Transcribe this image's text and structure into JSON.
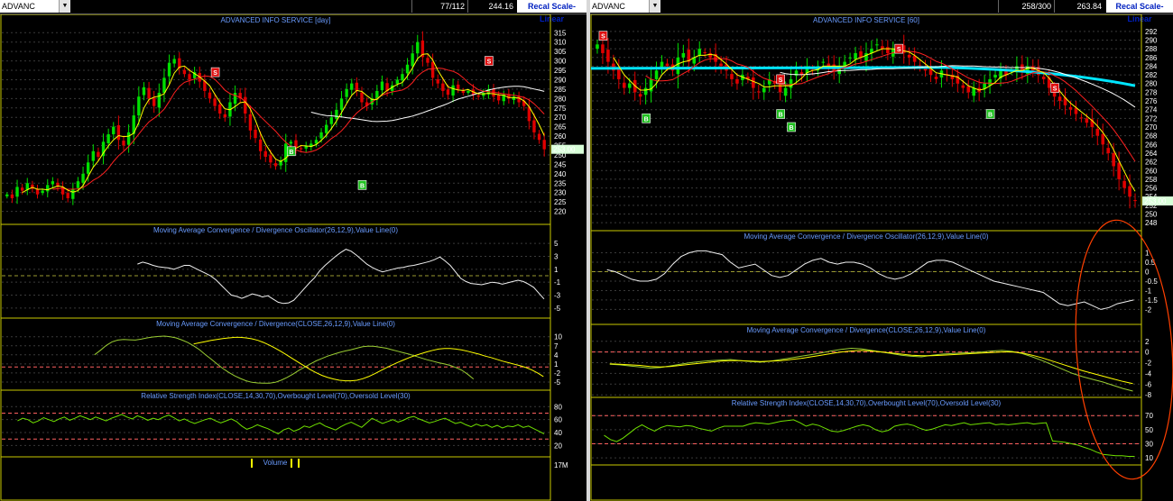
{
  "left": {
    "symbol": "ADVANC",
    "counter": "77/112",
    "price_box": "244.16",
    "recal_label": "Recal Scale-Linear",
    "price_tag": "253.00"
  },
  "right": {
    "symbol": "ADVANC",
    "counter": "258/300",
    "price_box": "263.84",
    "recal_label": "Recal Scale-Linear",
    "price_tag": "253.00"
  },
  "colors": {
    "up": "#00e000",
    "down": "#e00000",
    "ma_fast": "#ffff00",
    "ma_mid": "#ff2020",
    "ma_slow": "#ffffff",
    "ma_cyan": "#00e5ff",
    "title": "#6a9cff",
    "frame": "#c8c800",
    "ref_line": "#ff6060",
    "ellipse": "#ff4000"
  },
  "chart_data": [
    {
      "type": "candlestick",
      "id": "left-price",
      "title": "ADVANCED INFO SERVICE [day]",
      "ylim": [
        215,
        318
      ],
      "yticks": [
        220,
        225,
        230,
        235,
        240,
        245,
        250,
        255,
        260,
        265,
        270,
        275,
        280,
        285,
        290,
        295,
        300,
        305,
        310,
        315
      ],
      "close": [
        229,
        227,
        233,
        231,
        235,
        232,
        229,
        231,
        234,
        236,
        233,
        229,
        227,
        232,
        236,
        240,
        246,
        252,
        249,
        257,
        261,
        265,
        258,
        255,
        262,
        271,
        281,
        286,
        280,
        276,
        283,
        291,
        299,
        301,
        296,
        293,
        290,
        294,
        289,
        284,
        280,
        276,
        272,
        270,
        278,
        283,
        280,
        272,
        263,
        259,
        252,
        249,
        246,
        244,
        247,
        256,
        257,
        254,
        253,
        255,
        256,
        258,
        262,
        266,
        270,
        274,
        280,
        285,
        288,
        284,
        278,
        276,
        280,
        284,
        289,
        284,
        287,
        290,
        293,
        298,
        304,
        310,
        302,
        299,
        291,
        288,
        284,
        282,
        287,
        285,
        283,
        284,
        282,
        281,
        283,
        285,
        281,
        279,
        282,
        280,
        281,
        278,
        276,
        268,
        262,
        258,
        253
      ],
      "signals": [
        {
          "label": "S",
          "idx": 41,
          "price": 294
        },
        {
          "label": "B",
          "idx": 56,
          "price": 252
        },
        {
          "label": "B",
          "idx": 70,
          "price": 234
        },
        {
          "label": "S",
          "idx": 95,
          "price": 300
        }
      ],
      "ma_fast": {
        "name": "fast",
        "period": 4
      },
      "ma_mid": {
        "name": "mid",
        "period": 10
      },
      "ma_slow": {
        "name": "slow",
        "period": 35,
        "start": 60
      }
    },
    {
      "type": "line",
      "id": "left-macd-osc",
      "title": "Moving Average Convergence / Divergence Oscillator(26,12,9),Value Line(0)",
      "ylim": [
        -6,
        6
      ],
      "yticks": [
        5,
        3,
        1,
        -1,
        -3,
        -5
      ],
      "zero": 0,
      "start": 25,
      "values": [
        1.8,
        2.1,
        1.9,
        1.6,
        1.4,
        1.3,
        1.2,
        1.0,
        1.3,
        1.6,
        1.6,
        1.2,
        0.8,
        0.4,
        0.0,
        -0.6,
        -1.4,
        -2.2,
        -3.0,
        -3.2,
        -3.5,
        -3.2,
        -2.8,
        -3.0,
        -3.3,
        -3.1,
        -3.6,
        -4.1,
        -4.3,
        -4.2,
        -3.8,
        -2.9,
        -2.0,
        -1.1,
        -0.3,
        0.8,
        1.6,
        2.3,
        3.0,
        3.6,
        4.1,
        3.8,
        3.2,
        2.5,
        1.8,
        1.3,
        0.9,
        0.6,
        0.8,
        1.0,
        1.2,
        1.3,
        1.5,
        1.6,
        1.8,
        2.0,
        2.2,
        2.5,
        2.9,
        2.3,
        1.6,
        0.6,
        -0.4,
        -0.9,
        -1.2,
        -1.3,
        -1.4,
        -1.2,
        -1.0,
        -1.1,
        -1.3,
        -1.1,
        -0.9,
        -0.7,
        -0.9,
        -1.3,
        -1.8,
        -2.7,
        -3.6
      ]
    },
    {
      "type": "line",
      "id": "left-macd",
      "title": "Moving Average Convergence / Divergence(CLOSE,26,12,9),Value Line(0)",
      "ylim": [
        -6.5,
        12
      ],
      "yticks": [
        10,
        7,
        4,
        1,
        -2,
        -5
      ],
      "zero": 0,
      "series": [
        {
          "name": "MACD",
          "color": "#9acd32",
          "start": 15,
          "values": [
            4.0,
            5.5,
            7.1,
            8.3,
            8.9,
            9.1,
            9.0,
            8.9,
            9.2,
            9.6,
            9.9,
            10.1,
            10.2,
            10.0,
            9.6,
            8.9,
            8.1,
            7.0,
            5.7,
            4.1,
            2.6,
            1.0,
            -0.5,
            -1.8,
            -2.9,
            -3.8,
            -4.6,
            -5.1,
            -5.3,
            -5.4,
            -5.4,
            -5.1,
            -4.4,
            -3.5,
            -2.4,
            -1.2,
            -0.1,
            1.0,
            2.0,
            2.8,
            3.6,
            4.2,
            4.8,
            5.3,
            5.7,
            6.2,
            6.7,
            6.9,
            6.8,
            6.5,
            6.2,
            5.7,
            5.2,
            4.7,
            4.2,
            3.6,
            3.0,
            2.4,
            1.9,
            1.4,
            1.0,
            0.5,
            -0.2,
            -1.1,
            -2.4,
            -4.0
          ]
        },
        {
          "name": "Signal",
          "color": "#ffff00",
          "start": 32,
          "values": [
            7.6,
            8.0,
            8.4,
            8.8,
            9.1,
            9.4,
            9.6,
            9.8,
            9.8,
            9.6,
            9.3,
            8.8,
            8.1,
            7.2,
            6.2,
            5.1,
            3.9,
            2.7,
            1.5,
            0.3,
            -0.9,
            -1.9,
            -2.8,
            -3.5,
            -4.0,
            -4.4,
            -4.6,
            -4.6,
            -4.4,
            -3.9,
            -3.2,
            -2.3,
            -1.3,
            -0.3,
            0.6,
            1.5,
            2.3,
            3.1,
            3.8,
            4.4,
            5.0,
            5.5,
            5.9,
            6.1,
            6.1,
            5.9,
            5.6,
            5.2,
            4.7,
            4.2,
            3.6,
            3.1,
            2.5,
            1.9,
            1.4,
            0.9,
            0.4,
            -0.2,
            -1.0,
            -2.0,
            -3.2
          ]
        }
      ]
    },
    {
      "type": "line",
      "id": "left-rsi",
      "title": "Relative Strength Index(CLOSE,14,30,70),Overbought Level(70),Oversold Level(30)",
      "ylim": [
        8,
        86
      ],
      "yticks": [
        80,
        60,
        40,
        20
      ],
      "overbought": 70,
      "oversold": 30,
      "start": 2,
      "values": [
        58,
        62,
        60,
        55,
        58,
        63,
        60,
        57,
        61,
        64,
        59,
        62,
        66,
        63,
        60,
        64,
        61,
        58,
        62,
        65,
        68,
        64,
        61,
        66,
        63,
        59,
        62,
        60,
        64,
        67,
        63,
        58,
        61,
        57,
        54,
        57,
        60,
        62,
        58,
        55,
        58,
        61,
        57,
        50,
        45,
        48,
        52,
        49,
        46,
        42,
        38,
        44,
        47,
        42,
        45,
        50,
        48,
        52,
        55,
        50,
        47,
        44,
        49,
        53,
        56,
        52,
        48,
        55,
        62,
        58,
        54,
        57,
        60,
        56,
        59,
        63,
        65,
        61,
        58,
        55,
        57,
        60,
        62,
        58,
        54,
        56,
        52,
        49,
        53,
        50,
        52,
        48,
        51,
        47,
        50,
        49,
        52,
        48,
        50,
        46,
        42,
        38
      ]
    },
    {
      "type": "bar",
      "id": "left-volume",
      "title": "Volume",
      "yticks": [
        "17M"
      ]
    },
    {
      "type": "candlestick",
      "id": "right-price",
      "title": "ADVANCED INFO SERVICE [60]",
      "ylim": [
        247,
        293
      ],
      "yticks": [
        292,
        290,
        288,
        286,
        284,
        282,
        280,
        278,
        276,
        274,
        272,
        270,
        268,
        266,
        264,
        262,
        260,
        258,
        256,
        254,
        252,
        250,
        248
      ],
      "close": [
        289,
        287,
        285,
        283,
        281,
        279,
        280,
        278,
        277,
        279,
        281,
        283,
        285,
        284,
        283,
        286,
        287,
        285,
        286,
        288,
        287,
        286,
        285,
        284,
        283,
        281,
        280,
        282,
        281,
        279,
        278,
        279,
        281,
        280,
        278,
        279,
        281,
        283,
        282,
        284,
        283,
        284,
        285,
        284,
        283,
        284,
        285,
        286,
        287,
        286,
        287,
        288,
        289,
        288,
        287,
        288,
        288,
        287,
        286,
        285,
        284,
        283,
        282,
        281,
        283,
        282,
        281,
        280,
        279,
        278,
        279,
        278,
        280,
        281,
        282,
        283,
        282,
        283,
        284,
        283,
        284,
        283,
        282,
        281,
        279,
        277,
        276,
        275,
        274,
        273,
        272,
        271,
        270,
        268,
        266,
        264,
        261,
        258,
        256,
        254,
        253
      ],
      "signals": [
        {
          "label": "S",
          "idx": 1,
          "price": 291
        },
        {
          "label": "B",
          "idx": 9,
          "price": 272
        },
        {
          "label": "S",
          "idx": 34,
          "price": 281
        },
        {
          "label": "B",
          "idx": 34,
          "price": 273
        },
        {
          "label": "B",
          "idx": 36,
          "price": 270
        },
        {
          "label": "S",
          "idx": 56,
          "price": 288
        },
        {
          "label": "B",
          "idx": 73,
          "price": 273
        },
        {
          "label": "S",
          "idx": 85,
          "price": 279
        }
      ],
      "ma_fast": {
        "name": "fast",
        "period": 4
      },
      "ma_mid": {
        "name": "mid",
        "period": 10
      },
      "ma_slow": {
        "name": "slow",
        "period": 35
      }
    },
    {
      "type": "line",
      "id": "right-macd-osc",
      "title": "Moving Average Convergence / Divergence Oscillator(26,12,9),Value Line(0)",
      "ylim": [
        -2.6,
        1.5
      ],
      "yticks": [
        1,
        0.5,
        0,
        -0.5,
        -1,
        -1.5,
        -2
      ],
      "zero": 0,
      "start": 1,
      "values": [
        0.1,
        0.0,
        -0.2,
        -0.4,
        -0.5,
        -0.5,
        -0.4,
        -0.1,
        0.4,
        0.8,
        1.0,
        1.1,
        1.1,
        1.0,
        0.9,
        0.5,
        0.2,
        0.3,
        0.4,
        0.1,
        -0.2,
        -0.3,
        -0.2,
        0.1,
        0.4,
        0.6,
        0.7,
        0.5,
        0.4,
        0.5,
        0.5,
        0.4,
        0.2,
        -0.1,
        -0.3,
        -0.4,
        -0.3,
        -0.1,
        0.2,
        0.5,
        0.6,
        0.6,
        0.5,
        0.3,
        0.1,
        -0.1,
        -0.3,
        -0.5,
        -0.6,
        -0.7,
        -0.8,
        -0.9,
        -1.0,
        -1.1,
        -1.4,
        -1.7,
        -1.8,
        -1.7,
        -1.6,
        -1.8,
        -2.0,
        -1.9,
        -1.7,
        -1.6,
        -1.5
      ]
    },
    {
      "type": "line",
      "id": "right-macd",
      "title": "Moving Average Convergence / Divergence(CLOSE,26,12,9),Value Line(0)",
      "ylim": [
        -7.8,
        2.8
      ],
      "yticks": [
        2,
        0,
        -2,
        -4,
        -6,
        -8
      ],
      "zero": 0,
      "series": [
        {
          "name": "MACD",
          "color": "#9acd32",
          "start": 1,
          "values": [
            -2.3,
            -2.4,
            -2.6,
            -2.8,
            -3.0,
            -2.9,
            -2.6,
            -2.3,
            -2.0,
            -1.8,
            -1.6,
            -1.5,
            -1.4,
            -1.6,
            -1.8,
            -1.9,
            -1.7,
            -1.4,
            -1.1,
            -0.8,
            -0.5,
            -0.2,
            0.2,
            0.5,
            0.7,
            0.6,
            0.3,
            0.0,
            -0.3,
            -0.6,
            -0.8,
            -0.9,
            -0.6,
            -0.4,
            -0.3,
            -0.2,
            -0.1,
            0.0,
            0.2,
            0.3,
            0.1,
            -0.3,
            -0.9,
            -1.6,
            -2.4,
            -3.2,
            -4.0,
            -4.6,
            -5.1,
            -5.6,
            -6.2,
            -6.8,
            -7.3
          ]
        },
        {
          "name": "Signal",
          "color": "#ffff00",
          "start": 1,
          "values": [
            -2.2,
            -2.3,
            -2.4,
            -2.5,
            -2.7,
            -2.8,
            -2.7,
            -2.5,
            -2.3,
            -2.1,
            -1.9,
            -1.7,
            -1.6,
            -1.6,
            -1.7,
            -1.8,
            -1.7,
            -1.6,
            -1.4,
            -1.2,
            -0.9,
            -0.6,
            -0.3,
            0.0,
            0.2,
            0.3,
            0.2,
            0.0,
            -0.2,
            -0.4,
            -0.6,
            -0.7,
            -0.7,
            -0.6,
            -0.5,
            -0.4,
            -0.3,
            -0.2,
            -0.1,
            0.0,
            0.0,
            -0.2,
            -0.6,
            -1.1,
            -1.7,
            -2.3,
            -2.9,
            -3.5,
            -4.0,
            -4.5,
            -5.0,
            -5.5,
            -5.9
          ]
        }
      ]
    },
    {
      "type": "line",
      "id": "right-rsi",
      "title": "Relative Strength Index(CLOSE,14,30,70),Overbought Level(70),Oversold Level(30)",
      "ylim": [
        5,
        78
      ],
      "yticks": [
        70,
        50,
        30,
        10
      ],
      "overbought": 70,
      "oversold": 30,
      "start": 1,
      "values": [
        42,
        36,
        33,
        38,
        45,
        52,
        57,
        52,
        48,
        53,
        56,
        55,
        54,
        56,
        55,
        52,
        50,
        48,
        52,
        55,
        55,
        55,
        55,
        58,
        60,
        59,
        58,
        60,
        62,
        63,
        64,
        60,
        55,
        58,
        56,
        52,
        48,
        47,
        49,
        52,
        55,
        57,
        55,
        50,
        47,
        49,
        55,
        57,
        58,
        56,
        52,
        49,
        51,
        54,
        57,
        56,
        58,
        60,
        57,
        58,
        59,
        60,
        57,
        58,
        57,
        58,
        59,
        60,
        58,
        59,
        60,
        34,
        33,
        32,
        30,
        28,
        25,
        22,
        18,
        15,
        14,
        13,
        13,
        12,
        12
      ]
    }
  ]
}
